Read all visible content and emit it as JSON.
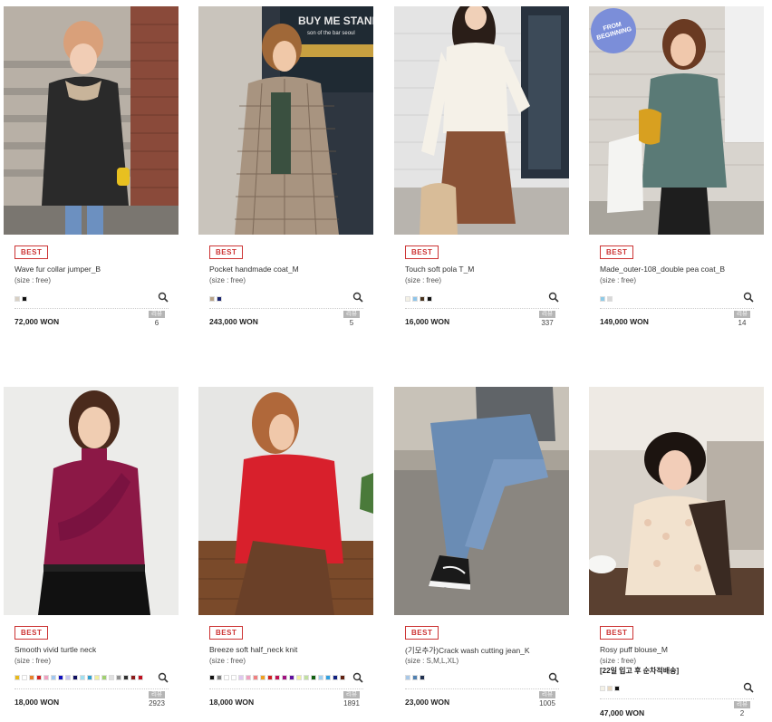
{
  "colors": {
    "best_badge": "#cc3333",
    "review_badge": "#b5b5b5",
    "from_badge": "#7b8ed9"
  },
  "products": [
    {
      "badge": "BEST",
      "name": "Wave fur collar jumper_B",
      "size": "(size : free)",
      "note": "",
      "swatches": [
        "#d8d0c4",
        "#111111"
      ],
      "price": "72,000 WON",
      "review_label": "리뷰",
      "review_count": "6",
      "image": "woman-beanie-quilted-jacket"
    },
    {
      "badge": "BEST",
      "name": "Pocket handmade coat_M",
      "size": "(size : free)",
      "note": "",
      "swatches": [
        "#b8a48a",
        "#1a2470"
      ],
      "price": "243,000 WON",
      "review_label": "리뷰",
      "review_count": "5",
      "image": "woman-check-coat-phone",
      "sign_text": "BUY ME STAND",
      "sign_sub": "son of the bar seoul"
    },
    {
      "badge": "BEST",
      "name": "Touch soft pola T_M",
      "size": "(size : free)",
      "note": "",
      "swatches": [
        "#f4f1e6",
        "#8ec5ea",
        "#4a3520",
        "#111111"
      ],
      "price": "16,000 WON",
      "review_label": "리뷰",
      "review_count": "337",
      "image": "woman-white-turtleneck-skirt"
    },
    {
      "badge": "BEST",
      "name": "Made_outer-108_double pea coat_B",
      "size": "(size : free)",
      "note": "",
      "swatches": [
        "#8ecbe8",
        "#d8d8d8"
      ],
      "price": "149,000 WON",
      "review_label": "리뷰",
      "review_count": "14",
      "image": "woman-green-pea-coat",
      "corner_badge": "FROM BEGINNING"
    },
    {
      "badge": "BEST",
      "name": "Smooth vivid turtle neck",
      "size": "(size : free)",
      "note": "",
      "swatches": [
        "#e8b91a",
        "#ffffff",
        "#e8822a",
        "#d42020",
        "#f0a0c0",
        "#a0c8f0",
        "#1010c0",
        "#c8c8f0",
        "#101060",
        "#a0e0f0",
        "#30a0d0",
        "#f0f0a0",
        "#a0d070",
        "#e0e0e0",
        "#909090",
        "#303030",
        "#8b1a1a",
        "#c01020"
      ],
      "price": "18,000 WON",
      "review_label": "리뷰",
      "review_count": "2923",
      "image": "woman-burgundy-turtleneck"
    },
    {
      "badge": "BEST",
      "name": "Breeze soft half_neck knit",
      "size": "(size : free)",
      "note": "",
      "swatches": [
        "#111111",
        "#808080",
        "#ffffff",
        "#ffffff",
        "#e0c8f0",
        "#f0a0c0",
        "#f08080",
        "#f0a020",
        "#d02020",
        "#c01050",
        "#a01080",
        "#6010a0",
        "#f0f0a0",
        "#c0e0a0",
        "#106010",
        "#a0d0f0",
        "#30a0e0",
        "#102080",
        "#602010"
      ],
      "price": "18,000 WON",
      "review_label": "리뷰",
      "review_count": "1891",
      "image": "woman-red-knit-sitting"
    },
    {
      "badge": "BEST",
      "name": "(기모추가)Crack wash cutting jean_K",
      "size": "(size : S,M,L,XL)",
      "note": "",
      "swatches": [
        "#a8c8e8",
        "#5080b0",
        "#203050"
      ],
      "price": "23,000 WON",
      "review_label": "리뷰",
      "review_count": "1005",
      "image": "jeans-sneakers-legs"
    },
    {
      "badge": "BEST",
      "name": "Rosy puff blouse_M",
      "size": "(size : free)",
      "note": "[22일 입고 후 순차적배송]",
      "swatches": [
        "#f4f1e6",
        "#e8d8c0",
        "#111111"
      ],
      "price": "47,000 WON",
      "review_label": "리뷰",
      "review_count": "2",
      "image": "woman-puff-blouse-kitchen"
    }
  ]
}
